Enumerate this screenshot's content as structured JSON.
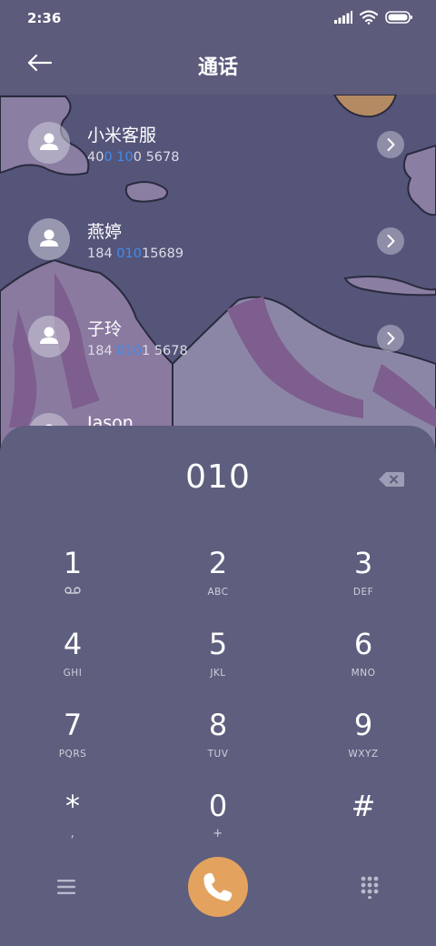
{
  "status_bar": {
    "time": "2:36",
    "icons": [
      "signal-icon",
      "wifi-icon",
      "battery-icon"
    ]
  },
  "header": {
    "title": "通话",
    "back_icon": "back-arrow-icon"
  },
  "contacts": [
    {
      "name": "小米客服",
      "number_parts": [
        "40",
        "0 10",
        "0 5678"
      ]
    },
    {
      "name": "燕婷",
      "number_parts": [
        "184 ",
        "010",
        "15689"
      ]
    },
    {
      "name": "子玲",
      "number_parts": [
        "184 ",
        "010",
        "1 5678"
      ]
    },
    {
      "name": "Jason"
    }
  ],
  "dialer": {
    "input_value": "010",
    "backspace_icon": "backspace-icon",
    "keys": [
      {
        "digit": "1",
        "sub_icon": "voicemail-icon"
      },
      {
        "digit": "2",
        "sub": "ABC"
      },
      {
        "digit": "3",
        "sub": "DEF"
      },
      {
        "digit": "4",
        "sub": "GHI"
      },
      {
        "digit": "5",
        "sub": "JKL"
      },
      {
        "digit": "6",
        "sub": "MNO"
      },
      {
        "digit": "7",
        "sub": "PQRS"
      },
      {
        "digit": "8",
        "sub": "TUV"
      },
      {
        "digit": "9",
        "sub": "WXYZ"
      },
      {
        "digit": "*",
        "sub": ","
      },
      {
        "digit": "0",
        "sub": "+"
      },
      {
        "digit": "#"
      }
    ],
    "bottom": {
      "menu_icon": "menu-icon",
      "call_icon": "phone-icon",
      "keypad_icon": "keypad-grid-icon"
    }
  },
  "colors": {
    "background": "#5e5e7e",
    "call_button": "#e3a35e",
    "highlight": "#3d8cf0"
  }
}
